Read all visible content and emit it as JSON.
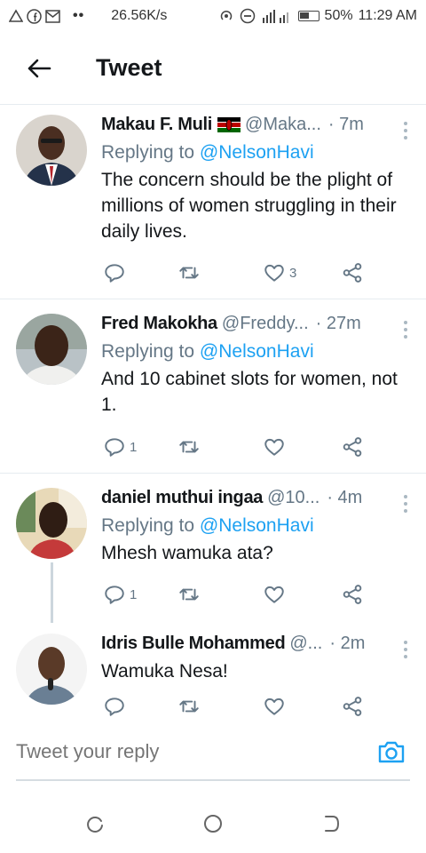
{
  "status_bar": {
    "speed": "26.56K/s",
    "battery": "50%",
    "time": "11:29 AM",
    "icons": [
      "alert-icon",
      "facebook-icon",
      "gmail-icon",
      "more-dots-icon",
      "hotspot-icon",
      "dnd-icon",
      "signal-icon",
      "battery-icon"
    ]
  },
  "header": {
    "title": "Tweet",
    "back_icon": "arrow-left-icon"
  },
  "tweets": [
    {
      "name": "Makau F. Muli",
      "handle": "@Maka...",
      "time": "· 7m",
      "reply_label": "Replying to",
      "reply_mention": "@NelsonHavi",
      "text": "The concern should be the plight of millions of women struggling in their daily lives.",
      "reply_count": "",
      "retweet_count": "",
      "like_count": "3",
      "flag": "kenya-flag-icon"
    },
    {
      "name": "Fred Makokha",
      "handle": "@Freddy...",
      "time": "· 27m",
      "reply_label": "Replying to",
      "reply_mention": "@NelsonHavi",
      "text": "And 10 cabinet slots for women, not 1.",
      "reply_count": "1",
      "retweet_count": "",
      "like_count": ""
    },
    {
      "name": "daniel muthui ingaa",
      "handle": "@10...",
      "time": "· 4m",
      "reply_label": "Replying to",
      "reply_mention": "@NelsonHavi",
      "text": "Mhesh wamuka ata?",
      "reply_count": "1",
      "retweet_count": "",
      "like_count": ""
    },
    {
      "name": "Idris Bulle Mohammed",
      "handle": "@...",
      "time": "· 2m",
      "text": "Wamuka Nesa!",
      "reply_count": "",
      "retweet_count": "",
      "like_count": ""
    }
  ],
  "composer": {
    "placeholder": "Tweet your reply",
    "camera_icon": "camera-icon"
  },
  "nav": [
    "recent-apps-icon",
    "home-icon",
    "back-icon"
  ],
  "colors": {
    "accent": "#1da1f2",
    "secondary_text": "#657786",
    "divider": "#e6ecf0"
  }
}
